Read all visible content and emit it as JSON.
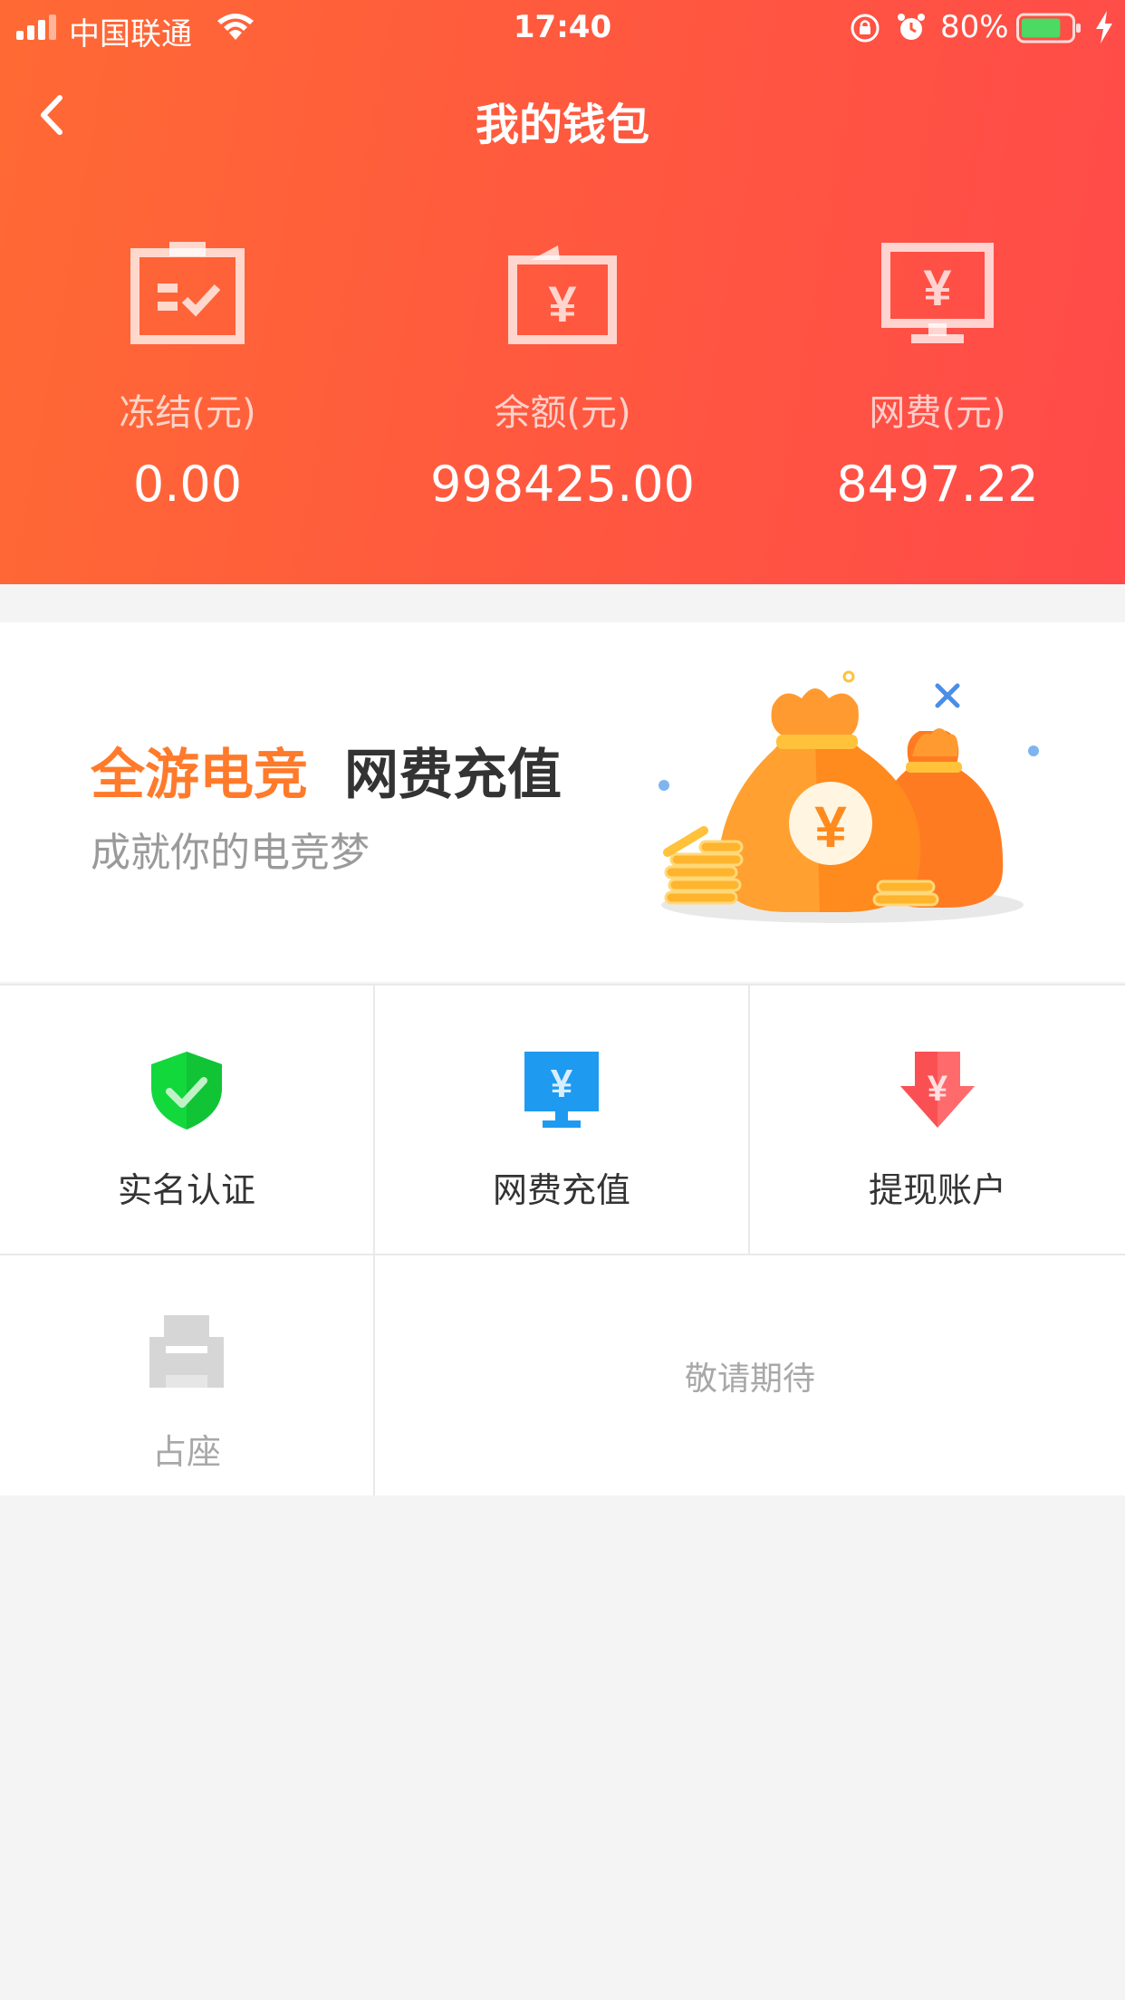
{
  "status_bar": {
    "carrier": "中国联通",
    "time": "17:40",
    "battery_percent": "80%",
    "battery_level": 0.8,
    "battery_color": "#4cd964"
  },
  "nav": {
    "title": "我的钱包",
    "back_icon": "chevron-left-icon"
  },
  "stats": [
    {
      "icon": "frozen-icon",
      "label": "冻结(元)",
      "value": "0.00"
    },
    {
      "icon": "balance-icon",
      "label": "余额(元)",
      "value": "998425.00"
    },
    {
      "icon": "net-fee-icon",
      "label": "网费(元)",
      "value": "8497.22"
    }
  ],
  "banner": {
    "title_highlight": "全游电竞",
    "title_rest": "网费充值",
    "subtitle": "成就你的电竞梦",
    "highlight_color": "#ff7a2a",
    "art_icon": "money-bags-icon"
  },
  "actions": [
    {
      "icon": "shield-check-icon",
      "label": "实名认证",
      "color": "#12d83c"
    },
    {
      "icon": "monitor-yuan-icon",
      "label": "网费充值",
      "color": "#1e9bf0"
    },
    {
      "icon": "withdraw-arrow-icon",
      "label": "提现账户",
      "color": "#fb5053"
    },
    {
      "icon": "seat-icon",
      "label": "占座",
      "color": "#d6d6d6"
    }
  ],
  "coming_soon": "敬请期待",
  "colors": {
    "header_gradient_start": "#ff6a34",
    "header_gradient_end": "#ff4a49",
    "page_background": "#f4f4f4"
  }
}
